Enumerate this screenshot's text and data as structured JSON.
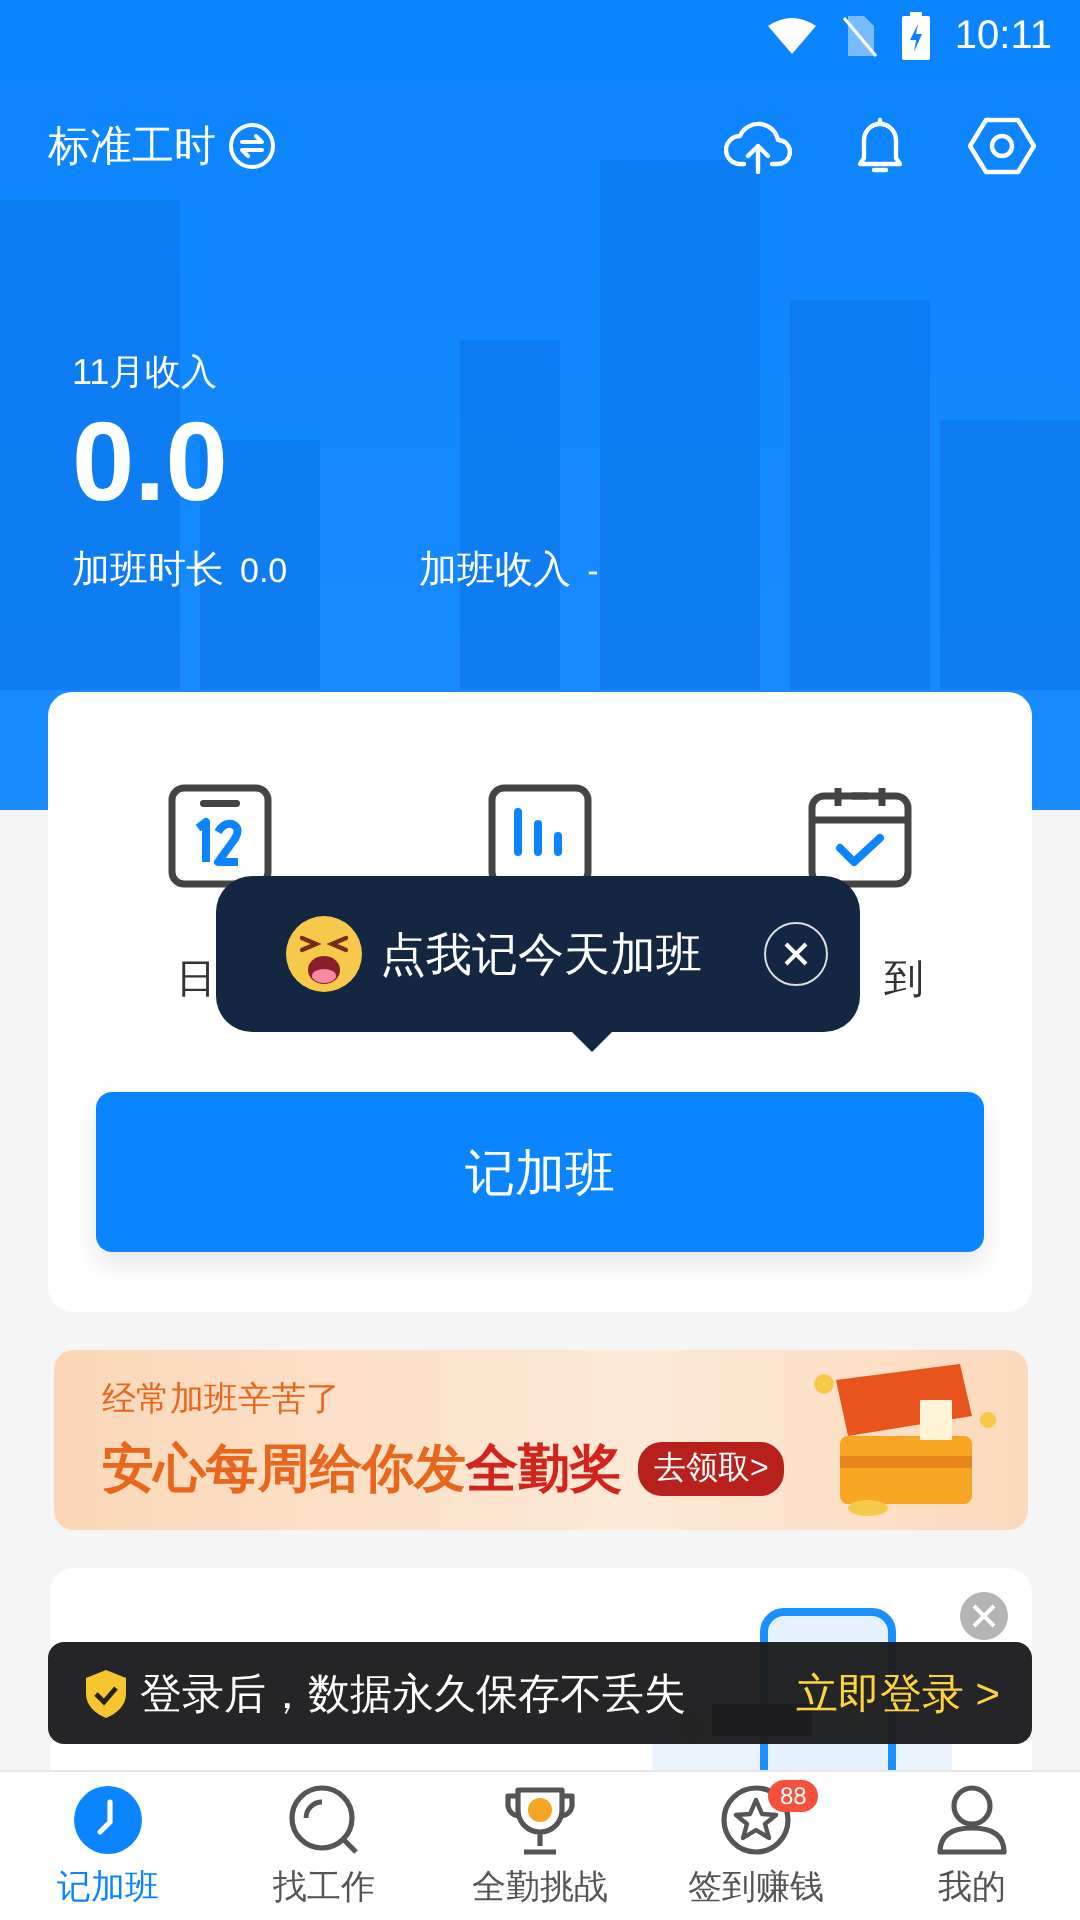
{
  "status_bar": {
    "time": "10:11"
  },
  "header": {
    "mode_label": "标准工时",
    "income_label": "11月收入",
    "income_value": "0.0",
    "stats": [
      {
        "label": "加班时长",
        "value": "0.0"
      },
      {
        "label": "加班收入",
        "value": "-"
      }
    ]
  },
  "tools": [
    {
      "kind": "calendar",
      "label": "日"
    },
    {
      "kind": "stats"
    },
    {
      "kind": "checkin",
      "label": "到"
    }
  ],
  "tooltip": {
    "text": "点我记今天加班"
  },
  "primary_button": {
    "label": "记加班"
  },
  "banner": {
    "subtitle": "经常加班辛苦了",
    "headline": "安心每周给你发",
    "highlight": "全勤奖",
    "action": "去领取>"
  },
  "login_toast": {
    "text": "登录后，数据永久保存不丢失",
    "action": "立即登录 >"
  },
  "nav": [
    {
      "label": "记加班",
      "selected": true
    },
    {
      "label": "找工作",
      "selected": false
    },
    {
      "label": "全勤挑战",
      "selected": false
    },
    {
      "label": "签到赚钱",
      "selected": false,
      "badge": "88"
    },
    {
      "label": "我的",
      "selected": false
    }
  ]
}
